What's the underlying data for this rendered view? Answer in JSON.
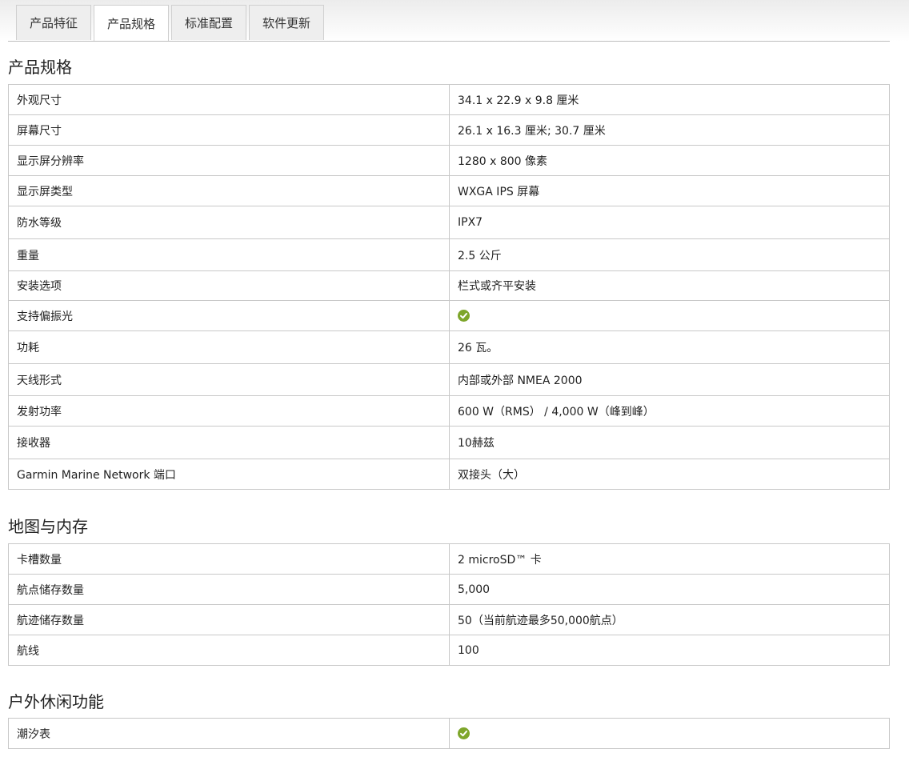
{
  "tabs": [
    {
      "label": "产品特征",
      "active": false
    },
    {
      "label": "产品规格",
      "active": true
    },
    {
      "label": "标准配置",
      "active": false
    },
    {
      "label": "软件更新",
      "active": false
    }
  ],
  "sections": [
    {
      "title": "产品规格",
      "rows": [
        {
          "key": "外观尺寸",
          "value": "34.1 x 22.9 x 9.8 厘米"
        },
        {
          "key": "屏幕尺寸",
          "value": "26.1 x 16.3 厘米; 30.7 厘米"
        },
        {
          "key": "显示屏分辨率",
          "value": "1280 x 800 像素"
        },
        {
          "key": "显示屏类型",
          "value": "WXGA IPS 屏幕"
        },
        {
          "key": "防水等级",
          "value": "IPX7"
        },
        {
          "key": "重量",
          "value": "2.5 公斤"
        },
        {
          "key": "安装选项",
          "value": "栏式或齐平安装"
        },
        {
          "key": "支持偏振光",
          "value": "",
          "check": true
        },
        {
          "key": "功耗",
          "value": "26 瓦。"
        },
        {
          "key": "天线形式",
          "value": "内部或外部 NMEA 2000"
        },
        {
          "key": "发射功率",
          "value": "600 W（RMS） / 4,000 W（峰到峰）"
        },
        {
          "key": "接收器",
          "value": "10赫兹"
        },
        {
          "key": "Garmin Marine Network 端口",
          "value": "双接头（大）"
        }
      ]
    },
    {
      "title": "地图与内存",
      "rows": [
        {
          "key": "卡槽数量",
          "value": "2 microSD™ 卡"
        },
        {
          "key": "航点储存数量",
          "value": "5,000"
        },
        {
          "key": "航迹储存数量",
          "value": "50（当前航迹最多50,000航点）"
        },
        {
          "key": "航线",
          "value": "100"
        }
      ]
    },
    {
      "title": "户外休闲功能",
      "rows": [
        {
          "key": "潮汐表",
          "value": "",
          "check": true
        }
      ]
    }
  ],
  "check_color": "#7ea62b"
}
